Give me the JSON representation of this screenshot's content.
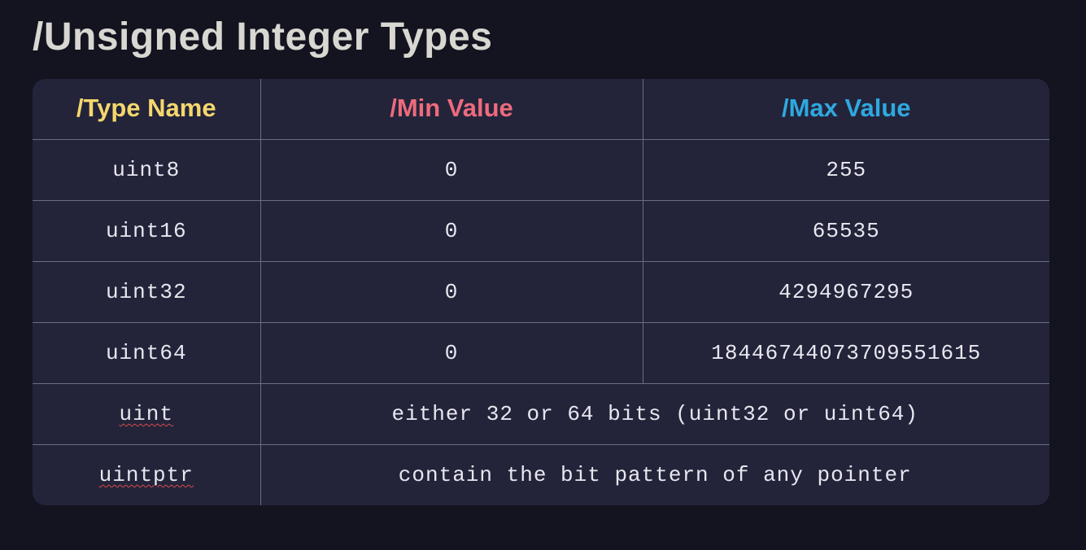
{
  "title": "Unsigned Integer Types",
  "slash": "/",
  "headers": {
    "type_name": "Type Name",
    "min_value": "Min Value",
    "max_value": "Max Value"
  },
  "rows": [
    {
      "name": "uint8",
      "min": "0",
      "max": "255",
      "wavy": false
    },
    {
      "name": "uint16",
      "min": "0",
      "max": "65535",
      "wavy": false
    },
    {
      "name": "uint32",
      "min": "0",
      "max": "4294967295",
      "wavy": false
    },
    {
      "name": "uint64",
      "min": "0",
      "max": "18446744073709551615",
      "wavy": false
    }
  ],
  "spanned_rows": [
    {
      "name": "uint",
      "desc": "either 32 or 64 bits (uint32 or uint64)",
      "wavy": true
    },
    {
      "name": "uintptr",
      "desc": "contain the bit pattern of any pointer",
      "wavy": true
    }
  ]
}
